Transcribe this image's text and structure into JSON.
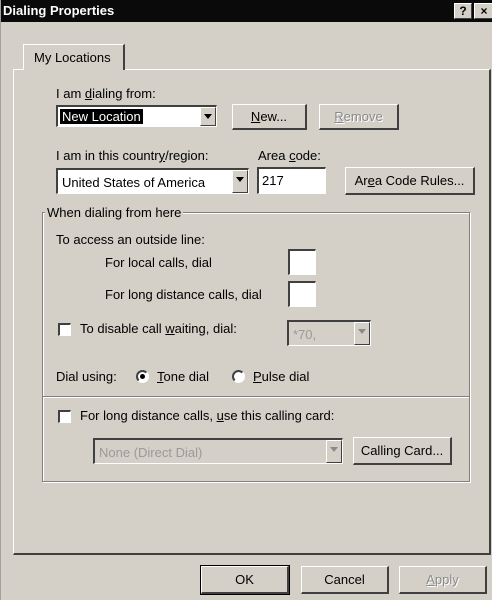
{
  "window": {
    "title": "Dialing Properties",
    "help_glyph": "?",
    "close_glyph": "×"
  },
  "tabs": [
    {
      "label": "My Locations"
    }
  ],
  "dialing_from": {
    "label_pre": "I am ",
    "label_ul": "d",
    "label_post": "ialing from:",
    "value": "New Location",
    "new_button": {
      "ul": "N",
      "rest": "ew..."
    },
    "remove_button": {
      "ul": "R",
      "rest": "emove"
    }
  },
  "country": {
    "label_pre": "I am in this countr",
    "label_ul": "y",
    "label_post": "/region:",
    "value": "United States of America"
  },
  "area_code": {
    "label_pre": "Area ",
    "label_ul": "c",
    "label_post": "ode:",
    "value": "217",
    "rules_button": {
      "pre": "Ar",
      "ul": "e",
      "post": "a Code Rules..."
    }
  },
  "when_dialing": {
    "legend": "When dialing from here",
    "outside_line_label": "To access an outside line:",
    "local_label": "For local calls, dial",
    "local_value": "",
    "long_distance_label": "For long distance calls, dial",
    "long_distance_value": "",
    "call_waiting": {
      "pre": "To disable call ",
      "ul": "w",
      "post": "aiting, dial:",
      "value": "*70,"
    },
    "dial_using_label": "Dial using:",
    "tone": {
      "ul": "T",
      "rest": "one dial",
      "selected": true
    },
    "pulse": {
      "ul": "P",
      "rest": "ulse dial",
      "selected": false
    },
    "calling_card": {
      "pre": "For long distance calls, ",
      "ul": "u",
      "post": "se this calling card:",
      "value": "None (Direct Dial)",
      "button": "Calling Card..."
    }
  },
  "footer": {
    "ok": "OK",
    "cancel": "Cancel",
    "apply": {
      "ul": "A",
      "rest": "pply"
    }
  }
}
